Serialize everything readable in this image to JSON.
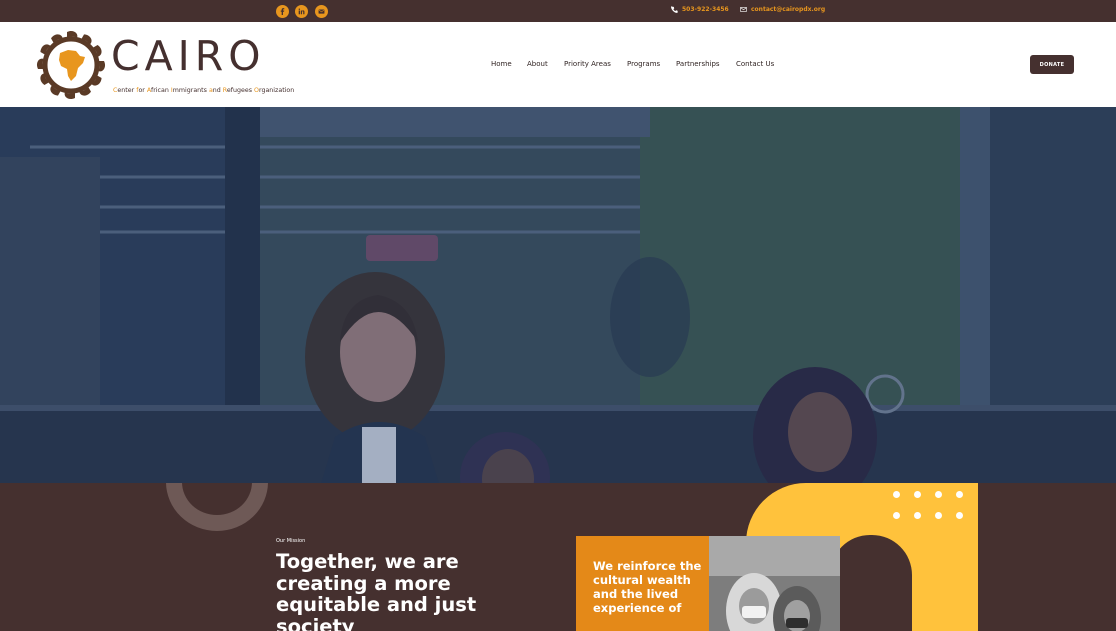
{
  "topbar": {
    "social_icons": [
      "facebook-icon",
      "linkedin-icon",
      "email-icon"
    ],
    "phone": "503-922-3456",
    "email": "contact@cairopdx.org"
  },
  "brand": {
    "name": "CAIRO",
    "tagline": "Center for African Immigrants and Refugees Organization"
  },
  "nav": {
    "items": [
      "Home",
      "About",
      "Priority Areas",
      "Programs",
      "Partnerships",
      "Contact Us"
    ]
  },
  "header": {
    "donate_label": "DONATE"
  },
  "mission": {
    "eyebrow": "Our Mission",
    "headline": "Together, we are creating a more equitable and just society",
    "card_text": "We reinforce the cultural wealth and the lived experience of"
  },
  "colors": {
    "brown": "#45302f",
    "orange": "#e8961e",
    "yellow": "#ffc23c",
    "white": "#ffffff"
  }
}
